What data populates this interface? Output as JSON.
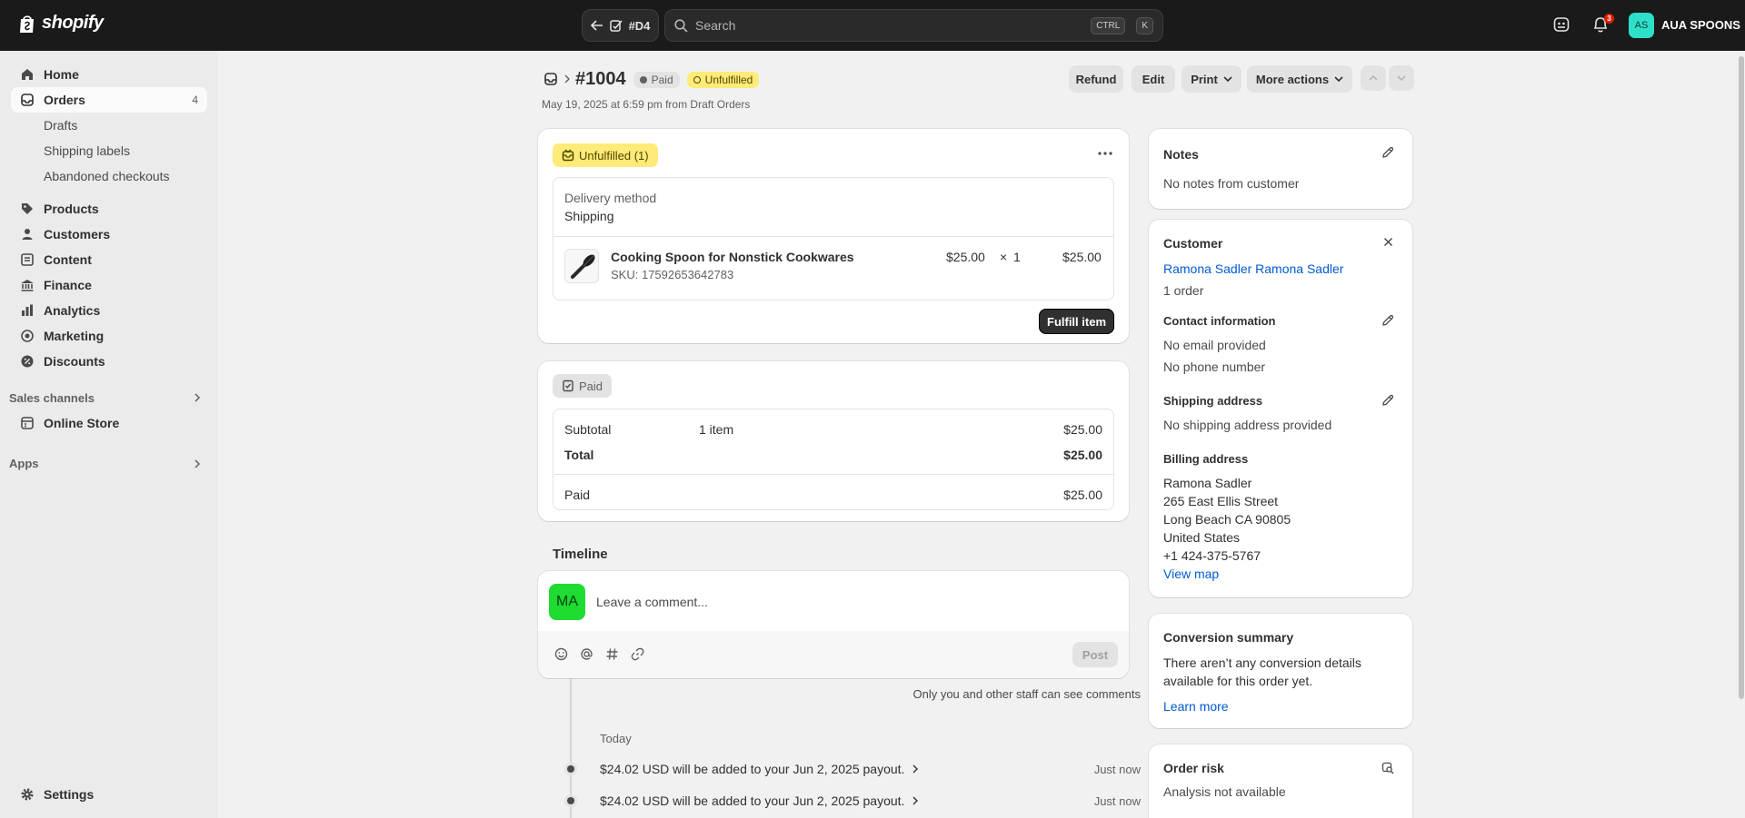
{
  "topbar": {
    "logo_text": "shopify",
    "back_label": "#D4",
    "search_placeholder": "Search",
    "shortcut_ctrl": "CTRL",
    "shortcut_key": "K",
    "notification_count": "3",
    "avatar_initials": "AS",
    "store_name": "AUA SPOONS"
  },
  "sidebar": {
    "home": "Home",
    "orders": "Orders",
    "orders_count": "4",
    "drafts": "Drafts",
    "shipping_labels": "Shipping labels",
    "abandoned_checkouts": "Abandoned checkouts",
    "products": "Products",
    "customers": "Customers",
    "content": "Content",
    "finance": "Finance",
    "analytics": "Analytics",
    "marketing": "Marketing",
    "discounts": "Discounts",
    "sales_channels": "Sales channels",
    "online_store": "Online Store",
    "apps": "Apps",
    "settings": "Settings"
  },
  "header": {
    "order_number": "#1004",
    "payment_badge": "Paid",
    "fulfillment_badge": "Unfulfilled",
    "order_date": "May 19, 2025 at 6:59 pm from Draft Orders",
    "refund": "Refund",
    "edit": "Edit",
    "print": "Print",
    "more_actions": "More actions"
  },
  "fulfillment": {
    "badge": "Unfulfilled (1)",
    "delivery_label": "Delivery method",
    "delivery_value": "Shipping",
    "item_name": "Cooking Spoon for Nonstick Cookwares",
    "item_sku": "SKU: 17592653642783",
    "item_price": "$25.00",
    "item_times": "×",
    "item_qty": "1",
    "item_total": "$25.00",
    "fulfill_button": "Fulfill item"
  },
  "payment": {
    "badge": "Paid",
    "subtotal_label": "Subtotal",
    "subtotal_items": "1 item",
    "subtotal_value": "$25.00",
    "total_label": "Total",
    "total_value": "$25.00",
    "paid_label": "Paid",
    "paid_value": "$25.00"
  },
  "timeline": {
    "title": "Timeline",
    "avatar_initials": "MA",
    "comment_placeholder": "Leave a comment...",
    "post_button": "Post",
    "staff_note": "Only you and other staff can see comments",
    "day_label": "Today",
    "events": [
      {
        "text": "$24.02 USD will be added to your Jun 2, 2025 payout.",
        "time": "Just now"
      },
      {
        "text": "$24.02 USD will be added to your Jun 2, 2025 payout.",
        "time": "Just now"
      }
    ]
  },
  "notes": {
    "title": "Notes",
    "text": "No notes from customer"
  },
  "customer": {
    "title": "Customer",
    "name": "Ramona Sadler Ramona Sadler",
    "orders": "1 order",
    "contact_title": "Contact information",
    "email": "No email provided",
    "phone": "No phone number",
    "shipping_title": "Shipping address",
    "shipping_text": "No shipping address provided",
    "billing_title": "Billing address",
    "billing_lines": [
      "Ramona Sadler",
      "265 East Ellis Street",
      "Long Beach CA 90805",
      "United States",
      "+1 424-375-5767"
    ],
    "view_map": "View map"
  },
  "conversion": {
    "title": "Conversion summary",
    "line1": "There aren’t any conversion details",
    "line2": "available for this order yet.",
    "learn_more": "Learn more"
  },
  "risk": {
    "title": "Order risk",
    "text": "Analysis not available"
  },
  "colors": {
    "topbar": "#1a1a1a",
    "accent_link": "#005bd3",
    "unfulfilled_badge": "#ffeb78",
    "avatar_store": "#2ee0c9",
    "avatar_comment": "#1edc32"
  },
  "icons": [
    "shopify-bag-icon",
    "arrow-left-icon",
    "draft-order-icon",
    "search-icon",
    "terminal-icon",
    "bell-icon",
    "home-icon",
    "inbox-icon",
    "tag-icon",
    "person-icon",
    "content-icon",
    "bank-icon",
    "bar-chart-icon",
    "target-icon",
    "discount-icon",
    "store-icon",
    "gear-icon",
    "chevron-right-icon",
    "chevron-down-icon",
    "chevron-up-icon",
    "dots-icon",
    "pencil-icon",
    "close-icon",
    "emoji-icon",
    "at-icon",
    "hash-icon",
    "link-icon",
    "receipt-icon",
    "risk-icon"
  ]
}
